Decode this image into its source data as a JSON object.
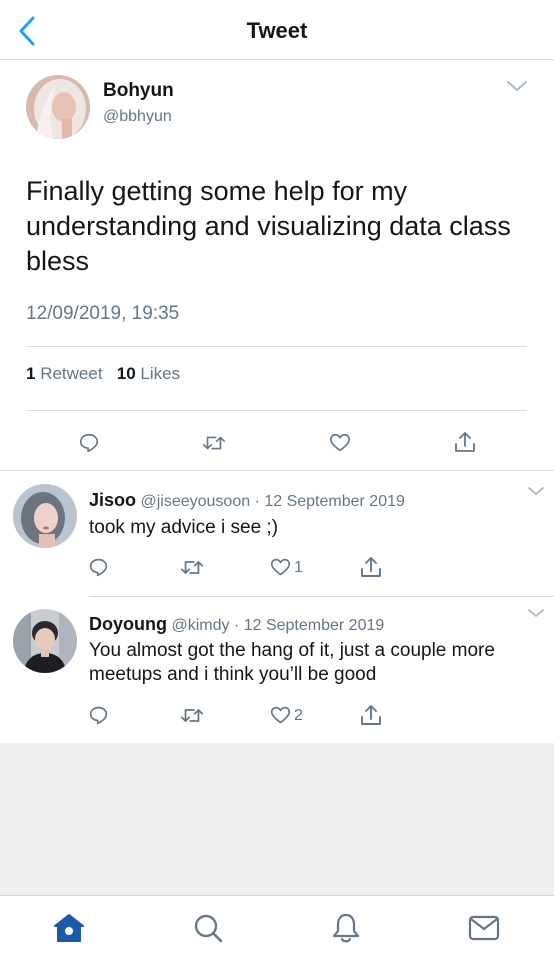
{
  "header": {
    "title": "Tweet"
  },
  "main_tweet": {
    "name": "Bohyun",
    "handle": "@bbhyun",
    "text": "Finally getting some help for my understanding and visualizing data class bless",
    "timestamp": "12/09/2019, 19:35",
    "retweet_count": "1",
    "retweet_label": "Retweet",
    "like_count": "10",
    "like_label": "Likes"
  },
  "replies": [
    {
      "name": "Jisoo",
      "handle": "@jiseeyousoon",
      "separator": "·",
      "date": "12 September 2019",
      "text": "took my advice i see ;)",
      "like_count": "1"
    },
    {
      "name": "Doyoung",
      "handle": "@kimdy",
      "separator": "·",
      "date": "12 September 2019",
      "text": "You almost got the hang of it, just a couple more meetups and i think you’ll be good",
      "like_count": "2"
    }
  ],
  "tabs": [
    "home-icon",
    "search-icon",
    "notifications-icon",
    "messages-icon"
  ],
  "colors": {
    "accent": "#1da1f2",
    "tab_active": "#1a5aa8",
    "muted": "#657786",
    "text": "#14171a"
  }
}
